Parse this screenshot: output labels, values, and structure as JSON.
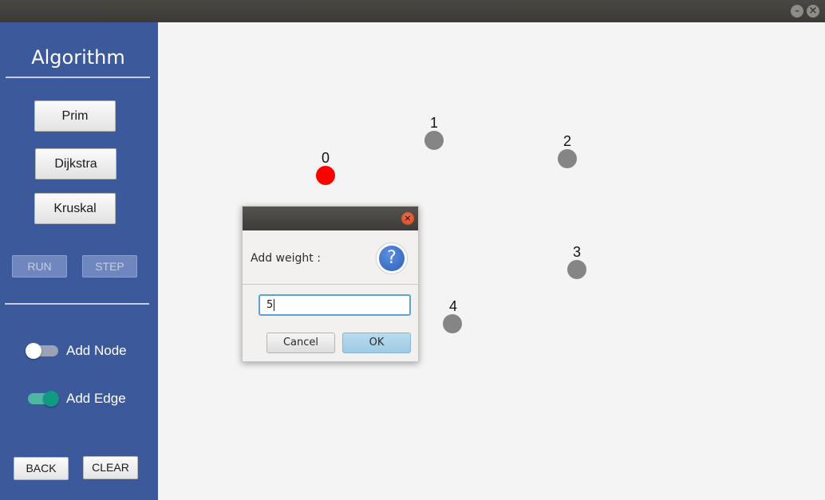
{
  "window": {
    "controls": [
      "minimize-icon",
      "close-icon"
    ]
  },
  "sidebar": {
    "title": "Algorithm",
    "algorithms": {
      "prim": "Prim",
      "dijkstra": "Dijkstra",
      "kruskal": "Kruskal"
    },
    "run_label": "RUN",
    "step_label": "STEP",
    "add_node": {
      "label": "Add Node",
      "enabled": false
    },
    "add_edge": {
      "label": "Add Edge",
      "enabled": true
    },
    "back_label": "BACK",
    "clear_label": "CLEAR",
    "colors": {
      "background": "#3c5a9b",
      "toggle_on": "#119a83"
    }
  },
  "graph": {
    "nodes": [
      {
        "label": "0",
        "selected": true,
        "color": "#ff0000"
      },
      {
        "label": "1",
        "selected": false,
        "color": "#858585"
      },
      {
        "label": "2",
        "selected": false,
        "color": "#858585"
      },
      {
        "label": "3",
        "selected": false,
        "color": "#858585"
      },
      {
        "label": "4",
        "selected": false,
        "color": "#858585"
      }
    ]
  },
  "dialog": {
    "message": "Add weight :",
    "icon": "question-icon",
    "input_value": "5",
    "cancel_label": "Cancel",
    "ok_label": "OK"
  }
}
